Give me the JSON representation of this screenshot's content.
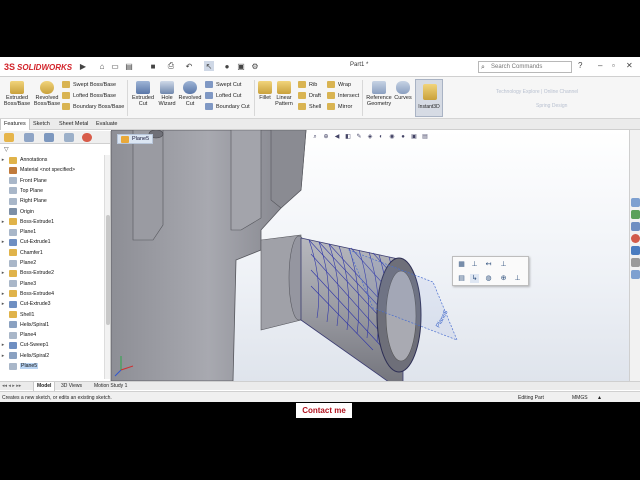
{
  "app": {
    "brand": "SOLIDWORKS",
    "brand_prefix": "3S",
    "document_title": "Part1 *",
    "search_placeholder": "Search Commands"
  },
  "ribbon": {
    "extruded_boss": "Extruded Boss/Base",
    "revolved_boss": "Revolved Boss/Base",
    "swept_boss": "Swept Boss/Base",
    "lofted_boss": "Lofted Boss/Base",
    "boundary_boss": "Boundary Boss/Base",
    "extruded_cut": "Extruded Cut",
    "hole_wizard": "Hole Wizard",
    "revolved_cut": "Revolved Cut",
    "swept_cut": "Swept Cut",
    "lofted_cut": "Lofted Cut",
    "boundary_cut": "Boundary Cut",
    "fillet": "Fillet",
    "linear_pattern": "Linear Pattern",
    "rib": "Rib",
    "draft": "Draft",
    "shell": "Shell",
    "wrap": "Wrap",
    "intersect": "Intersect",
    "mirror": "Mirror",
    "reference_geometry": "Reference Geometry",
    "curves": "Curves",
    "instant3d": "Instant3D"
  },
  "watermark": {
    "line1": "Technology Explore | Online Channel",
    "line2": "Spring Design"
  },
  "tabs": [
    "Features",
    "Sketch",
    "Sheet Metal",
    "Evaluate"
  ],
  "tree": {
    "items": [
      {
        "label": "Annotations",
        "expand": "▸",
        "color": "#e0b34a"
      },
      {
        "label": "Material <not specified>",
        "expand": "",
        "color": "#c07a3b"
      },
      {
        "label": "Front Plane",
        "expand": "",
        "color": "#a9b7c9"
      },
      {
        "label": "Top Plane",
        "expand": "",
        "color": "#a9b7c9"
      },
      {
        "label": "Right Plane",
        "expand": "",
        "color": "#a9b7c9"
      },
      {
        "label": "Origin",
        "expand": "",
        "color": "#7d8fa6"
      },
      {
        "label": "Boss-Extrude1",
        "expand": "▸",
        "color": "#e0b34a"
      },
      {
        "label": "Plane1",
        "expand": "",
        "color": "#a9b7c9"
      },
      {
        "label": "Cut-Extrude1",
        "expand": "▸",
        "color": "#6f8fc2"
      },
      {
        "label": "Chamfer1",
        "expand": "",
        "color": "#e0b34a"
      },
      {
        "label": "Plane2",
        "expand": "",
        "color": "#a9b7c9"
      },
      {
        "label": "Boss-Extrude2",
        "expand": "▸",
        "color": "#e0b34a"
      },
      {
        "label": "Plane3",
        "expand": "",
        "color": "#a9b7c9"
      },
      {
        "label": "Boss-Extrude4",
        "expand": "▸",
        "color": "#e0b34a"
      },
      {
        "label": "Cut-Extrude3",
        "expand": "▸",
        "color": "#6f8fc2"
      },
      {
        "label": "Shell1",
        "expand": "",
        "color": "#e0b34a"
      },
      {
        "label": "Helix/Spiral1",
        "expand": "",
        "color": "#8aa1c1"
      },
      {
        "label": "Plane4",
        "expand": "",
        "color": "#a9b7c9"
      },
      {
        "label": "Cut-Sweep1",
        "expand": "▸",
        "color": "#6f8fc2"
      },
      {
        "label": "Helix/Spiral2",
        "expand": "▸",
        "color": "#8aa1c1"
      },
      {
        "label": "Plane5",
        "expand": "",
        "color": "#a9b7c9",
        "selected": true
      }
    ]
  },
  "viewport": {
    "selected_plane": "Plane5",
    "plane_label": "Plane5"
  },
  "bottom_tabs": [
    "Model",
    "3D Views",
    "Motion Study 1"
  ],
  "status": {
    "message": "Creates a new sketch, or edits an existing sketch.",
    "mode": "Editing Part",
    "units": "MMGS"
  },
  "overlay": {
    "contact": "Contact me"
  }
}
